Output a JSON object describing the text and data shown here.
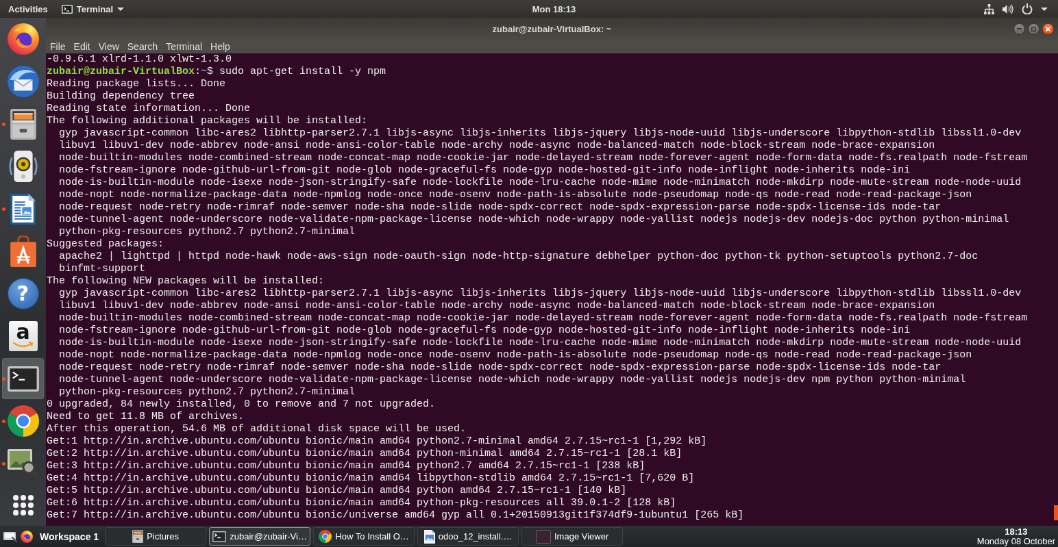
{
  "top_bar": {
    "activities": "Activities",
    "app_menu": "Terminal",
    "clock": "Mon 18:13"
  },
  "dock": {
    "items": [
      {
        "kind": "firefox",
        "running": false,
        "selected": false
      },
      {
        "kind": "thunderbird",
        "running": false,
        "selected": false
      },
      {
        "kind": "files",
        "running": true,
        "selected": false
      },
      {
        "kind": "rhythmbox",
        "running": false,
        "selected": false
      },
      {
        "kind": "writer",
        "running": true,
        "selected": false
      },
      {
        "kind": "software",
        "running": false,
        "selected": false
      },
      {
        "kind": "help",
        "glyph": "?",
        "running": false,
        "selected": false
      },
      {
        "kind": "amazon",
        "glyph": "a",
        "running": false,
        "selected": false
      },
      {
        "kind": "terminal",
        "running": true,
        "selected": true
      },
      {
        "kind": "chrome",
        "running": true,
        "selected": false
      },
      {
        "kind": "imageviewer",
        "running": true,
        "selected": false
      }
    ]
  },
  "window": {
    "title": "zubair@zubair-VirtualBox: ~",
    "menu": [
      "File",
      "Edit",
      "View",
      "Search",
      "Terminal",
      "Help"
    ]
  },
  "terminal": {
    "lines": [
      {
        "kind": "output",
        "text": "-0.9.6.1 xlrd-1.1.0 xlwt-1.3.0"
      },
      {
        "kind": "prompt",
        "parts": [
          {
            "kind": "user",
            "text": "zubair@zubair-VirtualBox"
          },
          {
            "kind": "plain",
            "text": ":"
          },
          {
            "kind": "path",
            "text": "~"
          },
          {
            "kind": "plain",
            "text": "$ sudo apt-get install -y npm"
          }
        ]
      },
      {
        "kind": "output",
        "text": "Reading package lists... Done"
      },
      {
        "kind": "output",
        "text": "Building dependency tree"
      },
      {
        "kind": "output",
        "text": "Reading state information... Done"
      },
      {
        "kind": "output",
        "text": "The following additional packages will be installed:"
      },
      {
        "kind": "output",
        "text": "  gyp javascript-common libc-ares2 libhttp-parser2.7.1 libjs-async libjs-inherits libjs-jquery libjs-node-uuid libjs-underscore libpython-stdlib libssl1.0-dev"
      },
      {
        "kind": "output",
        "text": "  libuv1 libuv1-dev node-abbrev node-ansi node-ansi-color-table node-archy node-async node-balanced-match node-block-stream node-brace-expansion"
      },
      {
        "kind": "output",
        "text": "  node-builtin-modules node-combined-stream node-concat-map node-cookie-jar node-delayed-stream node-forever-agent node-form-data node-fs.realpath node-fstream"
      },
      {
        "kind": "output",
        "text": "  node-fstream-ignore node-github-url-from-git node-glob node-graceful-fs node-gyp node-hosted-git-info node-inflight node-inherits node-ini"
      },
      {
        "kind": "output",
        "text": "  node-is-builtin-module node-isexe node-json-stringify-safe node-lockfile node-lru-cache node-mime node-minimatch node-mkdirp node-mute-stream node-node-uuid"
      },
      {
        "kind": "output",
        "text": "  node-nopt node-normalize-package-data node-npmlog node-once node-osenv node-path-is-absolute node-pseudomap node-qs node-read node-read-package-json"
      },
      {
        "kind": "output",
        "text": "  node-request node-retry node-rimraf node-semver node-sha node-slide node-spdx-correct node-spdx-expression-parse node-spdx-license-ids node-tar"
      },
      {
        "kind": "output",
        "text": "  node-tunnel-agent node-underscore node-validate-npm-package-license node-which node-wrappy node-yallist nodejs nodejs-dev nodejs-doc python python-minimal"
      },
      {
        "kind": "output",
        "text": "  python-pkg-resources python2.7 python2.7-minimal"
      },
      {
        "kind": "output",
        "text": "Suggested packages:"
      },
      {
        "kind": "output",
        "text": "  apache2 | lighttpd | httpd node-hawk node-aws-sign node-oauth-sign node-http-signature debhelper python-doc python-tk python-setuptools python2.7-doc"
      },
      {
        "kind": "output",
        "text": "  binfmt-support"
      },
      {
        "kind": "output",
        "text": "The following NEW packages will be installed:"
      },
      {
        "kind": "output",
        "text": "  gyp javascript-common libc-ares2 libhttp-parser2.7.1 libjs-async libjs-inherits libjs-jquery libjs-node-uuid libjs-underscore libpython-stdlib libssl1.0-dev"
      },
      {
        "kind": "output",
        "text": "  libuv1 libuv1-dev node-abbrev node-ansi node-ansi-color-table node-archy node-async node-balanced-match node-block-stream node-brace-expansion"
      },
      {
        "kind": "output",
        "text": "  node-builtin-modules node-combined-stream node-concat-map node-cookie-jar node-delayed-stream node-forever-agent node-form-data node-fs.realpath node-fstream"
      },
      {
        "kind": "output",
        "text": "  node-fstream-ignore node-github-url-from-git node-glob node-graceful-fs node-gyp node-hosted-git-info node-inflight node-inherits node-ini"
      },
      {
        "kind": "output",
        "text": "  node-is-builtin-module node-isexe node-json-stringify-safe node-lockfile node-lru-cache node-mime node-minimatch node-mkdirp node-mute-stream node-node-uuid"
      },
      {
        "kind": "output",
        "text": "  node-nopt node-normalize-package-data node-npmlog node-once node-osenv node-path-is-absolute node-pseudomap node-qs node-read node-read-package-json"
      },
      {
        "kind": "output",
        "text": "  node-request node-retry node-rimraf node-semver node-sha node-slide node-spdx-correct node-spdx-expression-parse node-spdx-license-ids node-tar"
      },
      {
        "kind": "output",
        "text": "  node-tunnel-agent node-underscore node-validate-npm-package-license node-which node-wrappy node-yallist nodejs nodejs-dev npm python python-minimal"
      },
      {
        "kind": "output",
        "text": "  python-pkg-resources python2.7 python2.7-minimal"
      },
      {
        "kind": "output",
        "text": "0 upgraded, 84 newly installed, 0 to remove and 7 not upgraded."
      },
      {
        "kind": "output",
        "text": "Need to get 11.8 MB of archives."
      },
      {
        "kind": "output",
        "text": "After this operation, 54.6 MB of additional disk space will be used."
      },
      {
        "kind": "output",
        "text": "Get:1 http://in.archive.ubuntu.com/ubuntu bionic/main amd64 python2.7-minimal amd64 2.7.15~rc1-1 [1,292 kB]"
      },
      {
        "kind": "output",
        "text": "Get:2 http://in.archive.ubuntu.com/ubuntu bionic/main amd64 python-minimal amd64 2.7.15~rc1-1 [28.1 kB]"
      },
      {
        "kind": "output",
        "text": "Get:3 http://in.archive.ubuntu.com/ubuntu bionic/main amd64 python2.7 amd64 2.7.15~rc1-1 [238 kB]"
      },
      {
        "kind": "output",
        "text": "Get:4 http://in.archive.ubuntu.com/ubuntu bionic/main amd64 libpython-stdlib amd64 2.7.15~rc1-1 [7,620 B]"
      },
      {
        "kind": "output",
        "text": "Get:5 http://in.archive.ubuntu.com/ubuntu bionic/main amd64 python amd64 2.7.15~rc1-1 [140 kB]"
      },
      {
        "kind": "output",
        "text": "Get:6 http://in.archive.ubuntu.com/ubuntu bionic/main amd64 python-pkg-resources all 39.0.1-2 [128 kB]"
      },
      {
        "kind": "output",
        "text": "Get:7 http://in.archive.ubuntu.com/ubuntu bionic/universe amd64 gyp all 0.1+20150913git1f374df9-1ubuntu1 [265 kB]"
      }
    ]
  },
  "taskbar": {
    "workspace": "Workspace 1",
    "tasks": [
      {
        "kind": "files",
        "label": "Pictures",
        "selected": false
      },
      {
        "kind": "terminal",
        "label": "zubair@zubair-Vi…",
        "selected": true
      },
      {
        "kind": "chrome",
        "label": "How To Install O…",
        "selected": false
      },
      {
        "kind": "imagefile",
        "label": "odoo_12_install.…",
        "selected": false
      },
      {
        "kind": "imageviewer",
        "label": "Image Viewer",
        "selected": false
      }
    ],
    "clock": {
      "time": "18:13",
      "date": "Monday 08 October"
    }
  }
}
